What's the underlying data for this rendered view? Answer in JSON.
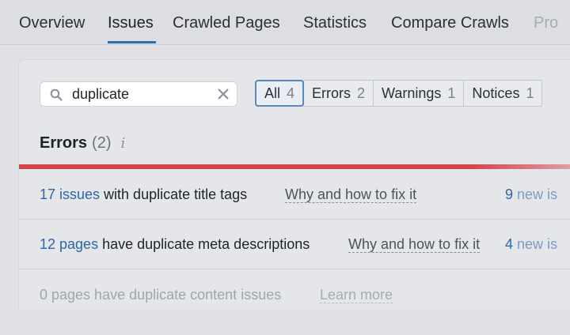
{
  "tabs": [
    {
      "label": "Overview"
    },
    {
      "label": "Issues"
    },
    {
      "label": "Crawled Pages"
    },
    {
      "label": "Statistics"
    },
    {
      "label": "Compare Crawls"
    },
    {
      "label": "Pro"
    }
  ],
  "search": {
    "value": "duplicate"
  },
  "filters": [
    {
      "label": "All",
      "count": "4"
    },
    {
      "label": "Errors",
      "count": "2"
    },
    {
      "label": "Warnings",
      "count": "1"
    },
    {
      "label": "Notices",
      "count": "1"
    }
  ],
  "section": {
    "title": "Errors",
    "count": "(2)",
    "info_glyph": "i",
    "accent_color": "#d5444b"
  },
  "rows": [
    {
      "link": "17 issues",
      "text": " with duplicate title tags",
      "fix": "Why and how to fix it",
      "new_count": "9",
      "new_label": " new is"
    },
    {
      "link": "12 pages",
      "text": " have duplicate meta descriptions",
      "fix": "Why and how to fix it",
      "new_count": "4",
      "new_label": " new is"
    },
    {
      "text": "0 pages have duplicate content issues",
      "fix": "Learn more"
    }
  ]
}
